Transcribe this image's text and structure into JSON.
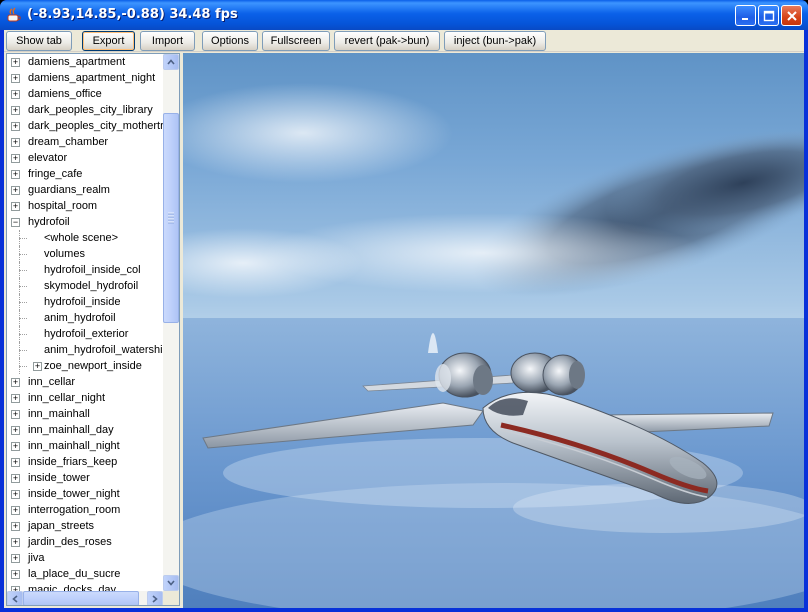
{
  "window": {
    "title": "(-8.93,14.85,-0.88) 34.48 fps"
  },
  "toolbar": {
    "buttons": [
      {
        "label": "Show tab"
      },
      {
        "label": "Export"
      },
      {
        "label": "Import"
      },
      {
        "label": "Options"
      },
      {
        "label": "Fullscreen"
      },
      {
        "label": "revert (pak->bun)"
      },
      {
        "label": "inject (bun->pak)"
      }
    ]
  },
  "tree": {
    "items": [
      {
        "label": "damiens_apartment",
        "level": 0,
        "expander": "+"
      },
      {
        "label": "damiens_apartment_night",
        "level": 0,
        "expander": "+"
      },
      {
        "label": "damiens_office",
        "level": 0,
        "expander": "+"
      },
      {
        "label": "dark_peoples_city_library",
        "level": 0,
        "expander": "+"
      },
      {
        "label": "dark_peoples_city_mothertre",
        "level": 0,
        "expander": "+"
      },
      {
        "label": "dream_chamber",
        "level": 0,
        "expander": "+"
      },
      {
        "label": "elevator",
        "level": 0,
        "expander": "+"
      },
      {
        "label": "fringe_cafe",
        "level": 0,
        "expander": "+"
      },
      {
        "label": "guardians_realm",
        "level": 0,
        "expander": "+"
      },
      {
        "label": "hospital_room",
        "level": 0,
        "expander": "+"
      },
      {
        "label": "hydrofoil",
        "level": 0,
        "expander": "-"
      },
      {
        "label": "<whole scene>",
        "level": 1,
        "expander": ""
      },
      {
        "label": "volumes",
        "level": 1,
        "expander": ""
      },
      {
        "label": "hydrofoil_inside_col",
        "level": 1,
        "expander": ""
      },
      {
        "label": "skymodel_hydrofoil",
        "level": 1,
        "expander": ""
      },
      {
        "label": "hydrofoil_inside",
        "level": 1,
        "expander": ""
      },
      {
        "label": "anim_hydrofoil",
        "level": 1,
        "expander": ""
      },
      {
        "label": "hydrofoil_exterior",
        "level": 1,
        "expander": ""
      },
      {
        "label": "anim_hydrofoil_watershine",
        "level": 1,
        "expander": ""
      },
      {
        "label": "zoe_newport_inside",
        "level": 1,
        "expander": "+"
      },
      {
        "label": "inn_cellar",
        "level": 0,
        "expander": "+"
      },
      {
        "label": "inn_cellar_night",
        "level": 0,
        "expander": "+"
      },
      {
        "label": "inn_mainhall",
        "level": 0,
        "expander": "+"
      },
      {
        "label": "inn_mainhall_day",
        "level": 0,
        "expander": "+"
      },
      {
        "label": "inn_mainhall_night",
        "level": 0,
        "expander": "+"
      },
      {
        "label": "inside_friars_keep",
        "level": 0,
        "expander": "+"
      },
      {
        "label": "inside_tower",
        "level": 0,
        "expander": "+"
      },
      {
        "label": "inside_tower_night",
        "level": 0,
        "expander": "+"
      },
      {
        "label": "interrogation_room",
        "level": 0,
        "expander": "+"
      },
      {
        "label": "japan_streets",
        "level": 0,
        "expander": "+"
      },
      {
        "label": "jardin_des_roses",
        "level": 0,
        "expander": "+"
      },
      {
        "label": "jiva",
        "level": 0,
        "expander": "+"
      },
      {
        "label": "la_place_du_sucre",
        "level": 0,
        "expander": "+"
      },
      {
        "label": "magic_docks_day",
        "level": 0,
        "expander": "+"
      }
    ]
  },
  "colors": {
    "titlebar": "#0b61e9",
    "window_frame": "#0831d9",
    "client_bg": "#ece9d8",
    "close_button": "#d64418"
  }
}
